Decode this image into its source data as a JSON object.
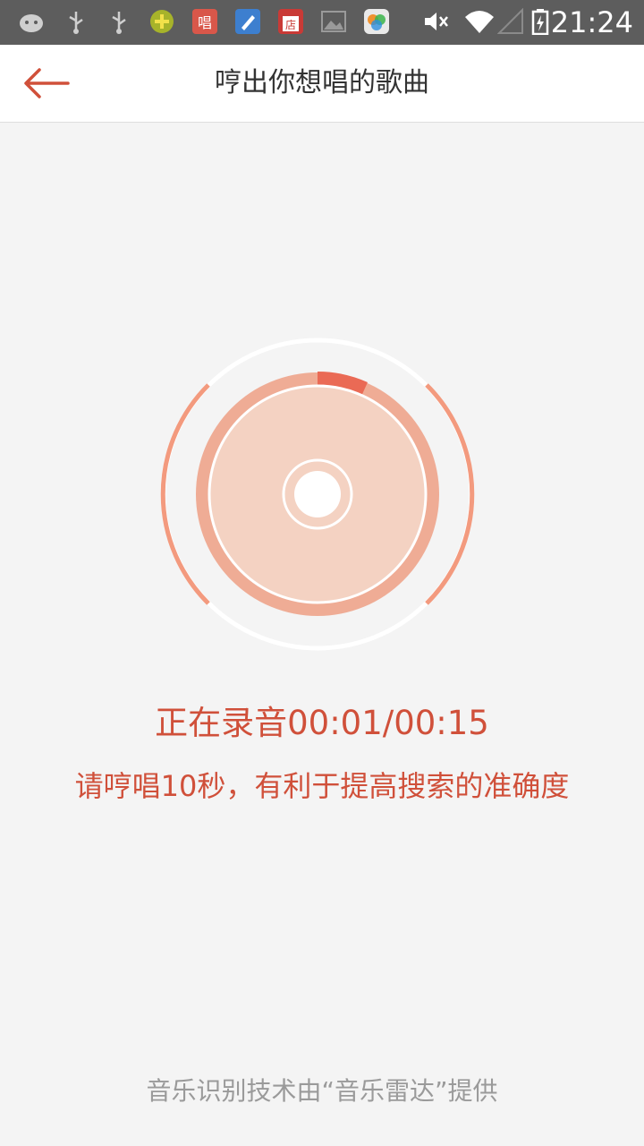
{
  "status_bar": {
    "time": "21:24",
    "icons": [
      "android-icon",
      "usb-icon",
      "usb-icon",
      "app-icon-green",
      "sing-app-icon",
      "clean-app-icon",
      "store-app-icon",
      "image-icon",
      "app-icon-colorful",
      "mute-icon",
      "wifi-icon",
      "no-signal-icon",
      "battery-charging-icon"
    ]
  },
  "header": {
    "title": "哼出你想唱的歌曲",
    "back_icon": "arrow-left-icon"
  },
  "recorder": {
    "status_text": "正在录音00:01/00:15",
    "progress_fraction": 0.067,
    "hint_text": "请哼唱10秒，有利于提高搜索的准确度"
  },
  "footer": {
    "credit_text": "音乐识别技术由“音乐雷达”提供"
  },
  "colors": {
    "accent": "#d0503a",
    "progress": "#ea6a55",
    "disc_ring": "#efac95",
    "disc_face": "#f4d2c2",
    "arc": "#f39a7e"
  }
}
